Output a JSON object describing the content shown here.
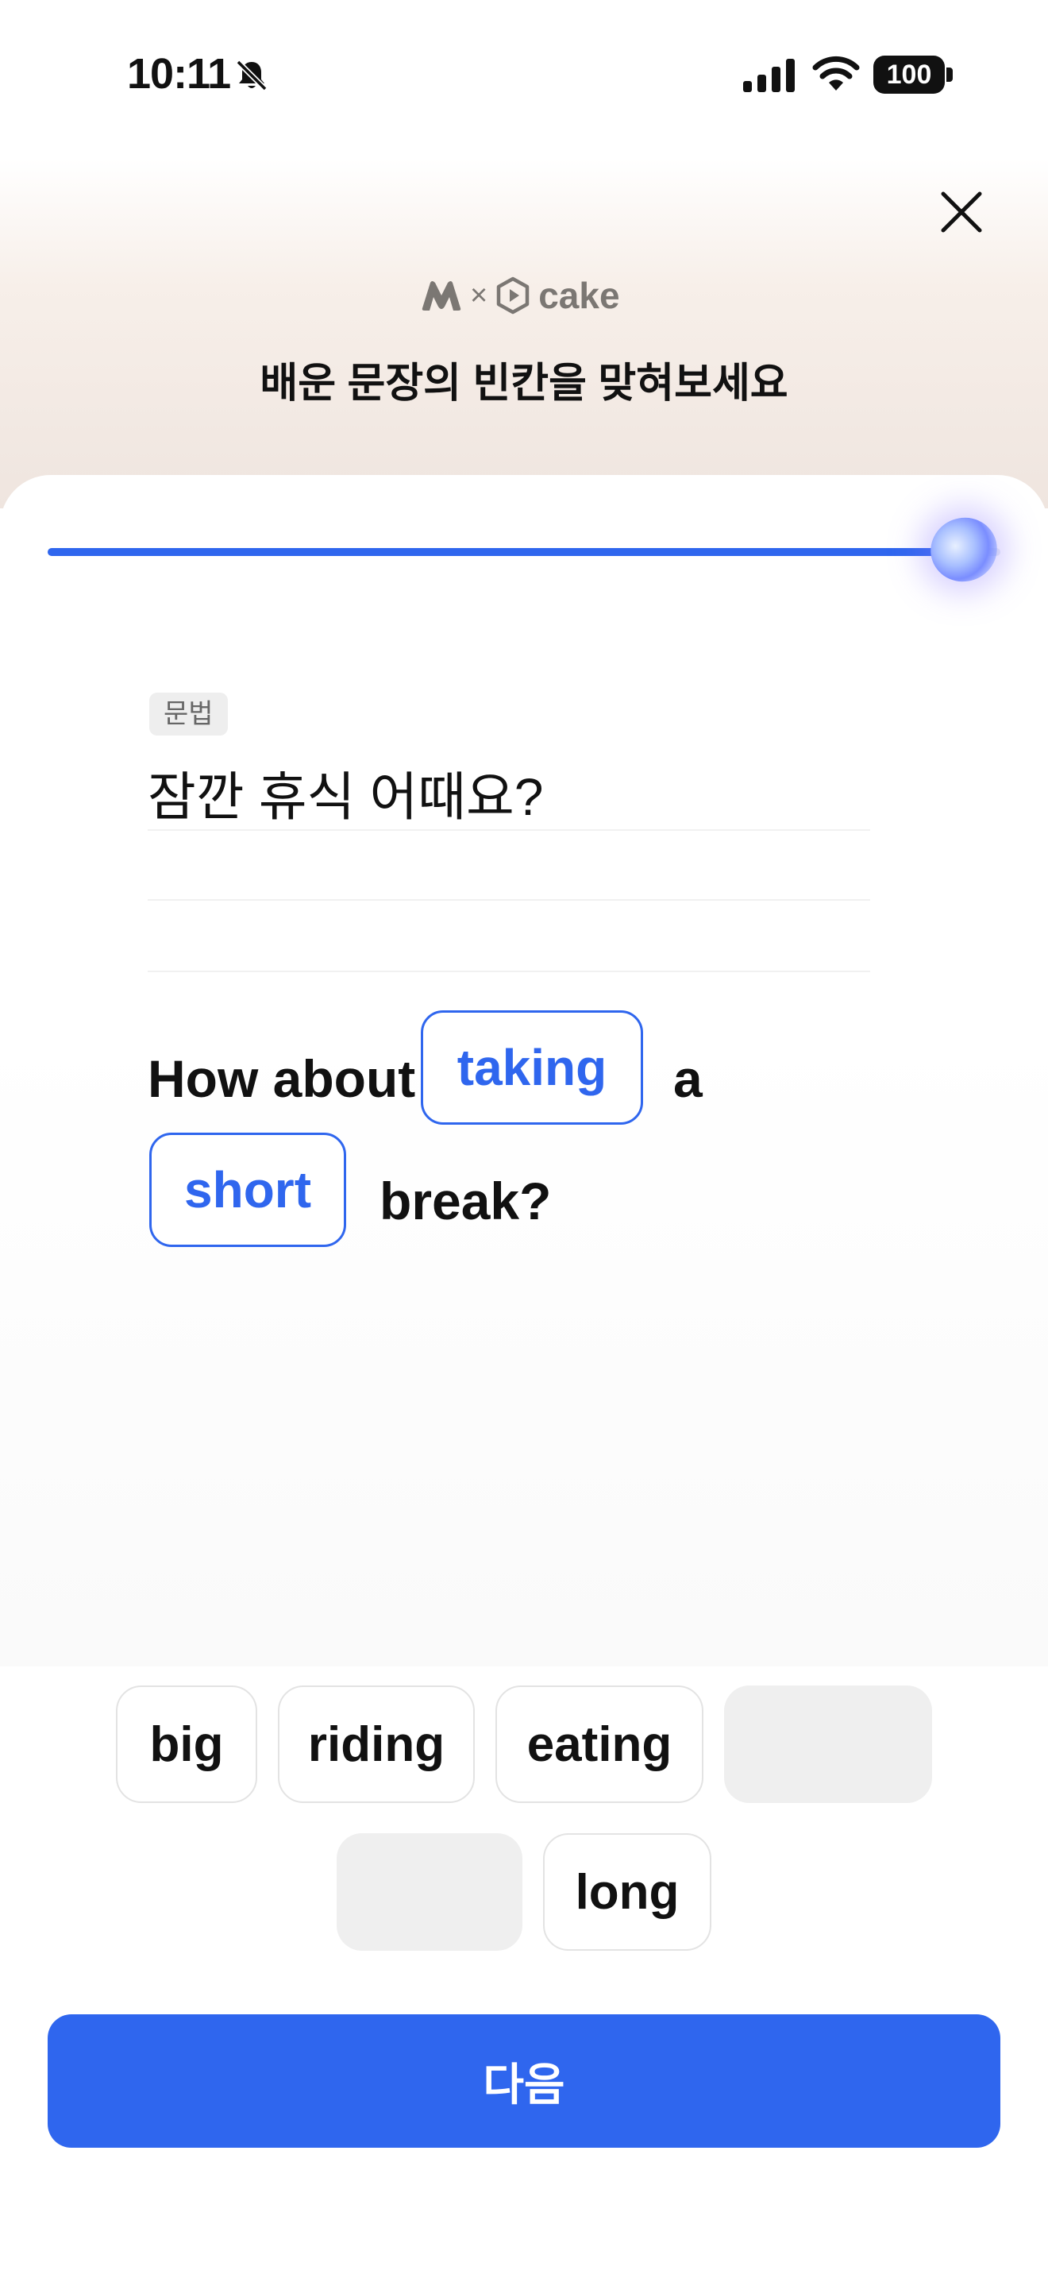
{
  "status_bar": {
    "time": "10:11",
    "battery": "100",
    "icons": [
      "bell-slash-icon",
      "signal-icon",
      "wifi-icon",
      "battery-icon"
    ]
  },
  "header": {
    "brand_x": "×",
    "brand_name": "cake",
    "title": "배운 문장의 빈칸을 맞혀보세요"
  },
  "progress": {
    "fraction": 0.96
  },
  "question": {
    "tag": "문법",
    "korean": "잠깐 휴식 어때요?",
    "sentence": {
      "w1": "How about",
      "blank1": "taking",
      "w2": "a",
      "blank2": "short",
      "w3": "break?"
    }
  },
  "choices": [
    "big",
    "riding",
    "eating",
    "",
    "",
    "long"
  ],
  "next_label": "다음",
  "colors": {
    "accent": "#2f66ee",
    "chip_used": "#efefef"
  }
}
